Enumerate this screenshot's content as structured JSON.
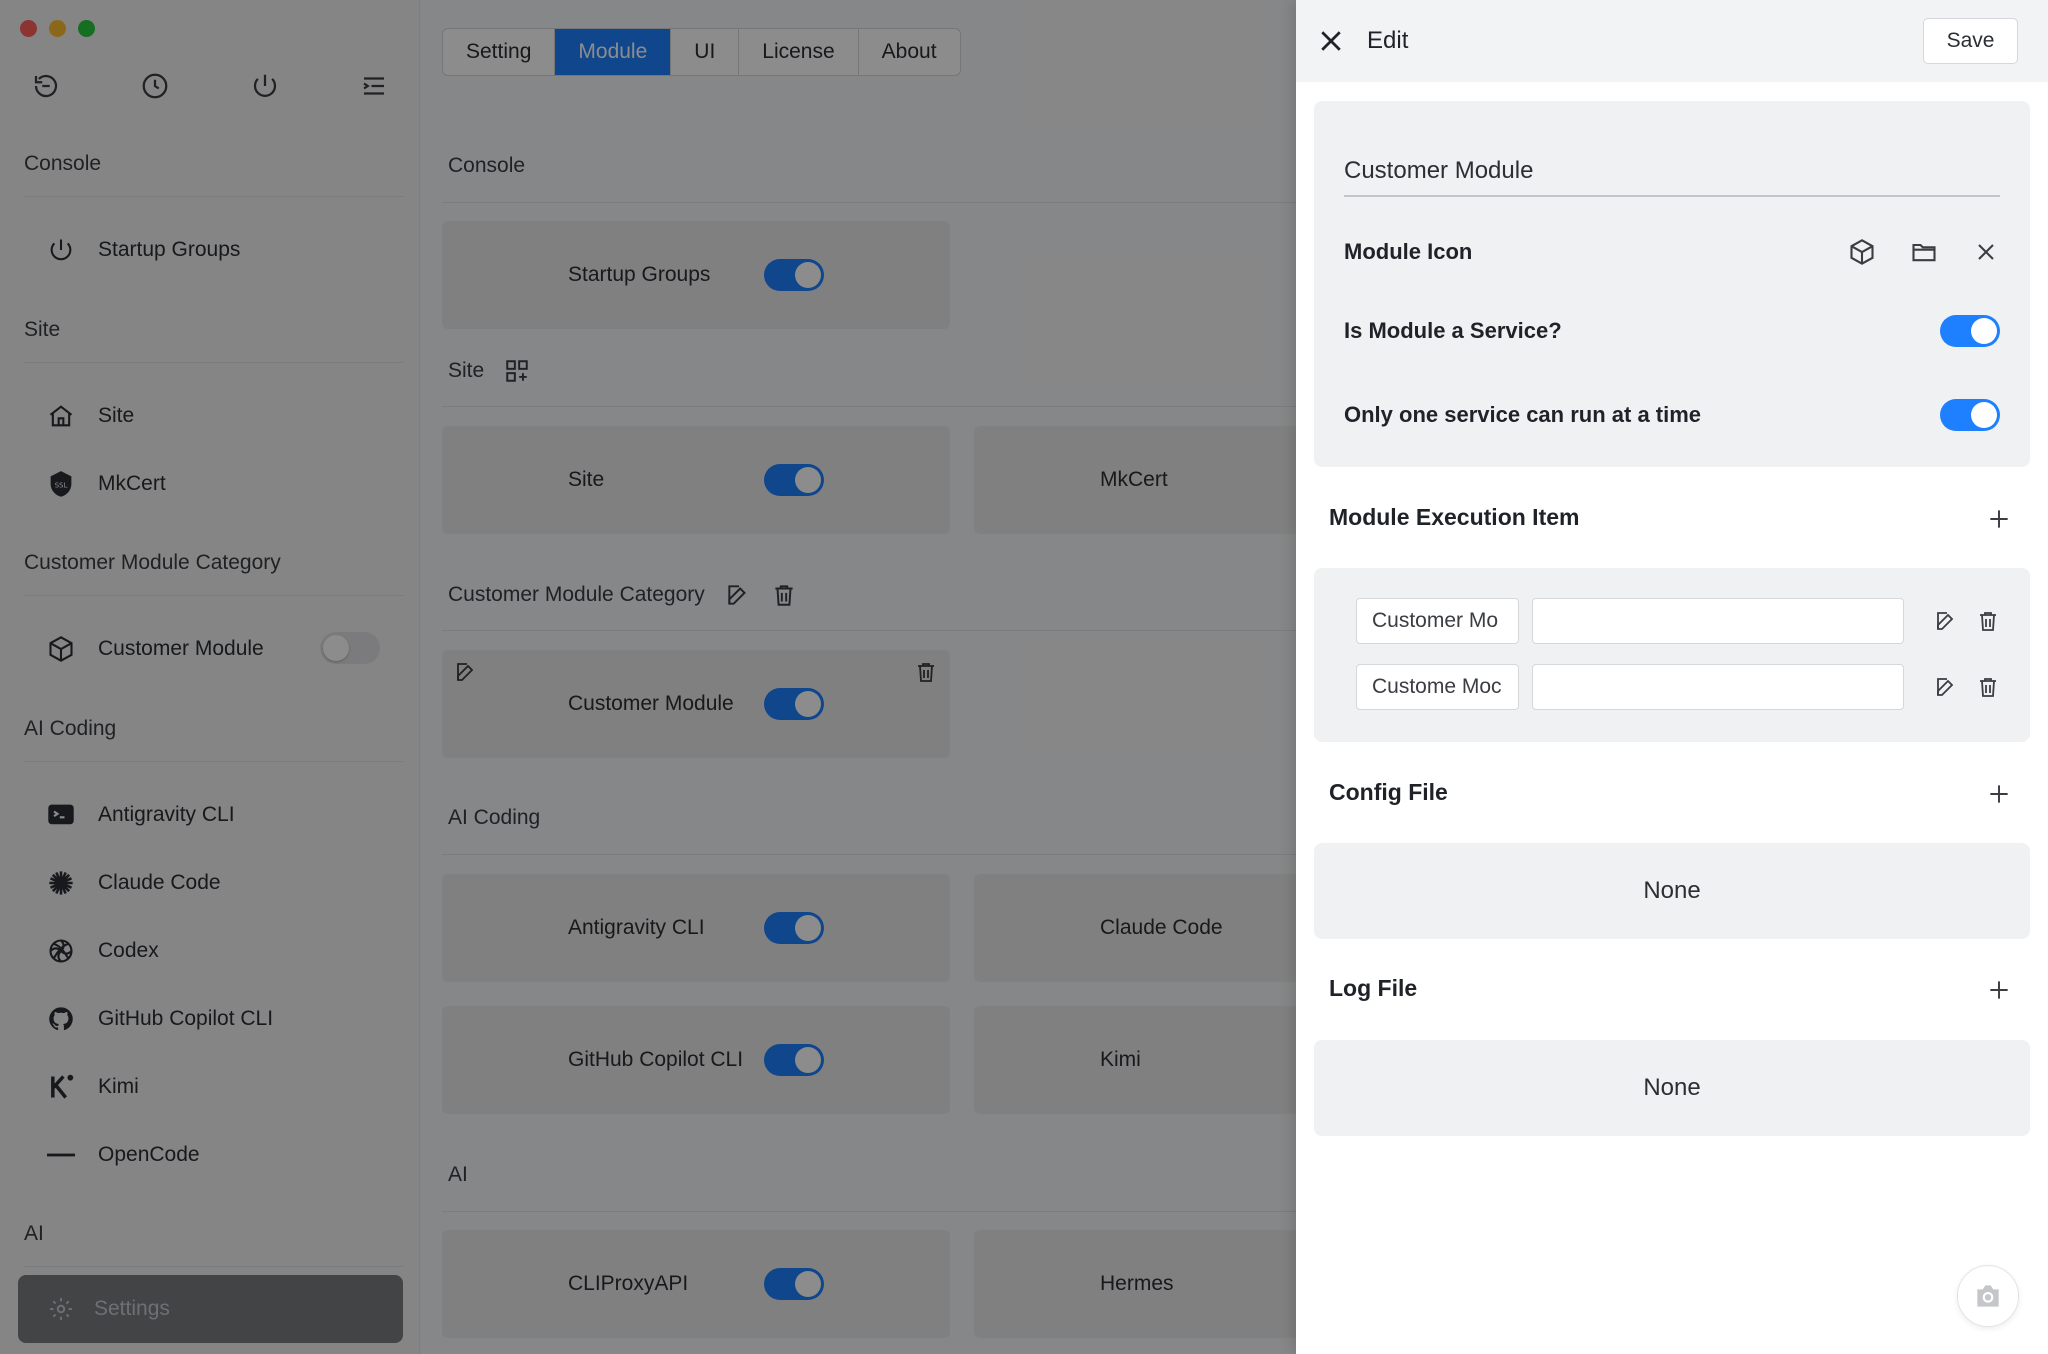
{
  "sidebar": {
    "sections": {
      "console": "Console",
      "site": "Site",
      "customer_module_category": "Customer Module Category",
      "ai_coding": "AI Coding",
      "ai": "AI"
    },
    "items": {
      "startup_groups": "Startup Groups",
      "site": "Site",
      "mkcert": "MkCert",
      "customer_module": "Customer Module",
      "antigravity": "Antigravity CLI",
      "claude": "Claude Code",
      "codex": "Codex",
      "copilot": "GitHub Copilot CLI",
      "kimi": "Kimi",
      "opencode": "OpenCode"
    },
    "settings_label": "Settings",
    "customer_module_enabled": false
  },
  "main": {
    "tabs": [
      "Setting",
      "Module",
      "UI",
      "License",
      "About"
    ],
    "active_tab": "Module",
    "sections": {
      "console": "Console",
      "site": "Site",
      "customer_module_category": "Customer Module Category",
      "ai_coding": "AI Coding",
      "ai": "AI"
    },
    "cards": {
      "startup_groups": "Startup Groups",
      "site": "Site",
      "mkcert": "MkCert",
      "customer_module": "Customer Module",
      "antigravity": "Antigravity CLI",
      "claude": "Claude Code",
      "copilot": "GitHub Copilot CLI",
      "kimi": "Kimi",
      "cliproxyapi": "CLIProxyAPI",
      "hermes": "Hermes"
    }
  },
  "drawer": {
    "title": "Edit",
    "save_label": "Save",
    "module_name": "Customer Module",
    "module_icon_label": "Module Icon",
    "is_service_label": "Is Module a Service?",
    "is_service": true,
    "single_service_label": "Only one service can run at a time",
    "single_service": true,
    "execution_items_title": "Module Execution Item",
    "execution_items": [
      {
        "name": "Customer Mo",
        "value": ""
      },
      {
        "name": "Custome Moc",
        "value": ""
      }
    ],
    "config_file_title": "Config File",
    "config_file_value": "None",
    "log_file_title": "Log File",
    "log_file_value": "None"
  },
  "colors": {
    "accent": "#1e80ff",
    "overlay": "rgba(0,0,0,0.45)"
  }
}
